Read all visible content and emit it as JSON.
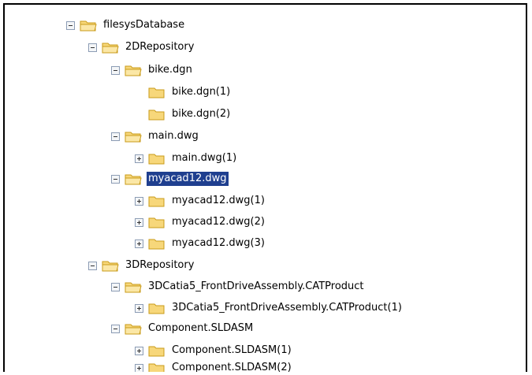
{
  "tree": {
    "root": {
      "label": "filesysDatabase",
      "icon": "folder-open-icon"
    },
    "repo2d": {
      "label": "2DRepository",
      "icon": "folder-open-icon"
    },
    "bike": {
      "label": "bike.dgn",
      "icon": "folder-open-icon"
    },
    "bike1": {
      "label": "bike.dgn(1)",
      "icon": "folder-icon"
    },
    "bike2": {
      "label": "bike.dgn(2)",
      "icon": "folder-icon"
    },
    "main": {
      "label": "main.dwg",
      "icon": "folder-open-icon"
    },
    "main1": {
      "label": "main.dwg(1)",
      "icon": "folder-icon"
    },
    "myacad": {
      "label": "myacad12.dwg",
      "icon": "folder-open-icon",
      "selected": true
    },
    "myacad1": {
      "label": "myacad12.dwg(1)",
      "icon": "folder-icon"
    },
    "myacad2": {
      "label": "myacad12.dwg(2)",
      "icon": "folder-icon"
    },
    "myacad3": {
      "label": "myacad12.dwg(3)",
      "icon": "folder-icon"
    },
    "repo3d": {
      "label": "3DRepository",
      "icon": "folder-open-icon"
    },
    "catia": {
      "label": "3DCatia5_FrontDriveAssembly.CATProduct",
      "icon": "folder-open-icon"
    },
    "catia1": {
      "label": "3DCatia5_FrontDriveAssembly.CATProduct(1)",
      "icon": "folder-icon"
    },
    "comp": {
      "label": "Component.SLDASM",
      "icon": "folder-open-icon"
    },
    "comp1": {
      "label": "Component.SLDASM(1)",
      "icon": "folder-icon"
    },
    "comp2": {
      "label": "Component.SLDASM(2)",
      "icon": "folder-icon"
    }
  },
  "colors": {
    "selection": "#1f3f8f",
    "folder_fill": "#f7d77a",
    "folder_stroke": "#c99b1a"
  }
}
